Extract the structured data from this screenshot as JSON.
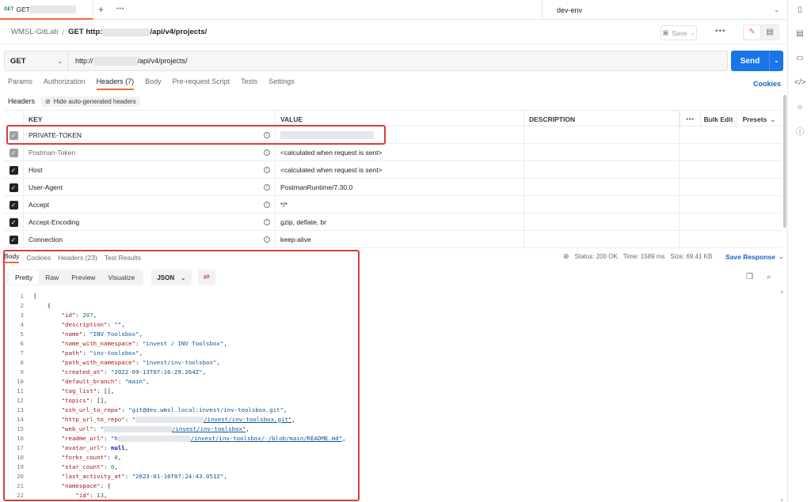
{
  "tabbar": {
    "active_tab": {
      "method": "GET",
      "title": "GET "
    },
    "add_icon": "+",
    "more_icon": "•••",
    "environment": "dev-env"
  },
  "breadcrumb": {
    "collection": "WMSL-GitLab",
    "separator": "/",
    "request_prefix": "GET http:",
    "request_suffix": "/api/v4/projects/"
  },
  "toolbar": {
    "save_label": "Save",
    "more": "•••"
  },
  "urlbar": {
    "method": "GET",
    "url_prefix": "http://",
    "url_suffix": "/api/v4/projects/",
    "send_label": "Send"
  },
  "request_tabs": [
    "Params",
    "Authorization",
    "Headers (7)",
    "Body",
    "Pre-request Script",
    "Tests",
    "Settings"
  ],
  "cookies_label": "Cookies",
  "headers_sub": {
    "label": "Headers",
    "hide_auto": "Hide auto-generated headers"
  },
  "headers_table": {
    "columns": {
      "key": "KEY",
      "value": "VALUE",
      "description": "DESCRIPTION",
      "more": "•••",
      "bulk_edit": "Bulk Edit",
      "presets": "Presets"
    },
    "rows": [
      {
        "key": "PRIVATE-TOKEN",
        "value": "",
        "checked": "grey"
      },
      {
        "key": "Postman-Token",
        "value": "<calculated when request is sent>",
        "checked": "grey"
      },
      {
        "key": "Host",
        "value": "<calculated when request is sent>",
        "checked": "black"
      },
      {
        "key": "User-Agent",
        "value": "PostmanRuntime/7.30.0",
        "checked": "black"
      },
      {
        "key": "Accept",
        "value": "*/*",
        "checked": "black"
      },
      {
        "key": "Accept-Encoding",
        "value": "gzip, deflate, br",
        "checked": "black"
      },
      {
        "key": "Connection",
        "value": "keep-alive",
        "checked": "black"
      }
    ]
  },
  "response_tabs": [
    "Body",
    "Cookies",
    "Headers (23)",
    "Test Results"
  ],
  "response_stats": {
    "status": "Status: 200 OK",
    "time": "Time: 1589 ms",
    "size": "Size: 69.41 KB",
    "save_response": "Save Response"
  },
  "view_modes": [
    "Pretty",
    "Raw",
    "Preview",
    "Visualize"
  ],
  "format": "JSON",
  "code_lines": [
    {
      "no": "1",
      "text": "["
    },
    {
      "no": "2",
      "text": "    {"
    },
    {
      "no": "3",
      "key": "\"id\"",
      "val": "207",
      "vtype": "n"
    },
    {
      "no": "4",
      "key": "\"description\"",
      "val": "\"\"",
      "vtype": "s"
    },
    {
      "no": "5",
      "key": "\"name\"",
      "val": "\"INV Toolsbox\"",
      "vtype": "s"
    },
    {
      "no": "6",
      "key": "\"name_with_namespace\"",
      "val": "\"invest / INV Toolsbox\"",
      "vtype": "s"
    },
    {
      "no": "7",
      "key": "\"path\"",
      "val": "\"inv-toolsbox\"",
      "vtype": "s"
    },
    {
      "no": "8",
      "key": "\"path_with_namespace\"",
      "val": "\"invest/inv-toolsbox\"",
      "vtype": "s"
    },
    {
      "no": "9",
      "key": "\"created_at\"",
      "val": "\"2022-09-13T07:16:29.264Z\"",
      "vtype": "s"
    },
    {
      "no": "10",
      "key": "\"default_branch\"",
      "val": "\"main\"",
      "vtype": "s"
    },
    {
      "no": "11",
      "key": "\"tag_list\"",
      "val": "[]",
      "vtype": "p"
    },
    {
      "no": "12",
      "key": "\"topics\"",
      "val": "[]",
      "vtype": "p"
    },
    {
      "no": "13",
      "key": "\"ssh_url_to_repo\"",
      "val": "\"git@dev.wmsl.local:invest/inv-toolsbox.git\"",
      "vtype": "s"
    },
    {
      "no": "14",
      "key": "\"http_url_to_repo\"",
      "val_prefix": "\"",
      "val": "/invest/inv-toolsbox.git\"",
      "vtype": "u"
    },
    {
      "no": "15",
      "key": "\"web_url\"",
      "val_prefix": "\"",
      "val": "/invest/inv-toolsbox\"",
      "vtype": "u"
    },
    {
      "no": "16",
      "key": "\"readme_url\"",
      "val_prefix": "\"h",
      "val": "/invest/inv-toolsbox/-/blob/main/README.md\"",
      "vtype": "u"
    },
    {
      "no": "17",
      "key": "\"avatar_url\"",
      "val": "null",
      "vtype": "kw"
    },
    {
      "no": "18",
      "key": "\"forks_count\"",
      "val": "0",
      "vtype": "n"
    },
    {
      "no": "19",
      "key": "\"star_count\"",
      "val": "0",
      "vtype": "n"
    },
    {
      "no": "20",
      "key": "\"last_activity_at\"",
      "val": "\"2023-01-16T07:24:43.051Z\"",
      "vtype": "s"
    },
    {
      "no": "21",
      "key": "\"namespace\"",
      "val": "{",
      "vtype": "open"
    },
    {
      "no": "22",
      "key": "\"id\"",
      "val": "13",
      "vtype": "n",
      "indent": 2
    }
  ],
  "colors": {
    "accent": "#f26b3a",
    "send": "#1976e6",
    "highlight": "#dc3b3b",
    "link": "#1565c0"
  }
}
